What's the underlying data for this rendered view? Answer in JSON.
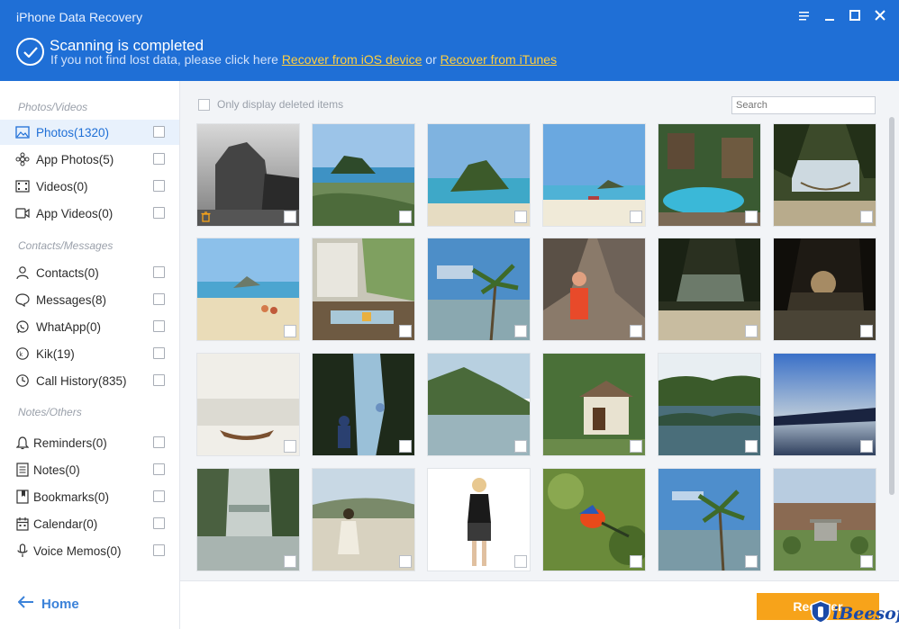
{
  "app": {
    "title": "iPhone Data Recovery"
  },
  "status": {
    "title": "Scanning is completed",
    "sub_prefix": "If you not find lost data, please click here ",
    "link_device": "Recover from iOS device",
    "sub_or": " or ",
    "link_itunes": "Recover from iTunes"
  },
  "sidebar": {
    "groups": [
      "Photos/Videos",
      "Contacts/Messages",
      "Notes/Others"
    ],
    "items": [
      {
        "label": "Photos(1320)",
        "icon": "image-icon"
      },
      {
        "label": "App Photos(5)",
        "icon": "flower-icon"
      },
      {
        "label": "Videos(0)",
        "icon": "film-icon"
      },
      {
        "label": "App Videos(0)",
        "icon": "video-camera-icon"
      },
      {
        "label": "Contacts(0)",
        "icon": "person-icon"
      },
      {
        "label": "Messages(8)",
        "icon": "chat-bubble-icon"
      },
      {
        "label": "WhatApp(0)",
        "icon": "whatsapp-icon"
      },
      {
        "label": "Kik(19)",
        "icon": "kik-icon"
      },
      {
        "label": "Call History(835)",
        "icon": "clock-icon"
      },
      {
        "label": "Reminders(0)",
        "icon": "bell-icon"
      },
      {
        "label": "Notes(0)",
        "icon": "note-icon"
      },
      {
        "label": "Bookmarks(0)",
        "icon": "bookmark-icon"
      },
      {
        "label": "Calendar(0)",
        "icon": "calendar-icon"
      },
      {
        "label": "Voice Memos(0)",
        "icon": "microphone-icon"
      }
    ],
    "home_label": "Home"
  },
  "main": {
    "only_deleted_label": "Only display deleted items",
    "search_placeholder": "Search"
  },
  "footer": {
    "recover_label": "Recover",
    "logo_text": "iBeesoft"
  },
  "colors": {
    "header": "#1f6fd6",
    "link": "#ffcf3f",
    "accent": "#1f6fd6",
    "recover": "#f7a31a"
  }
}
